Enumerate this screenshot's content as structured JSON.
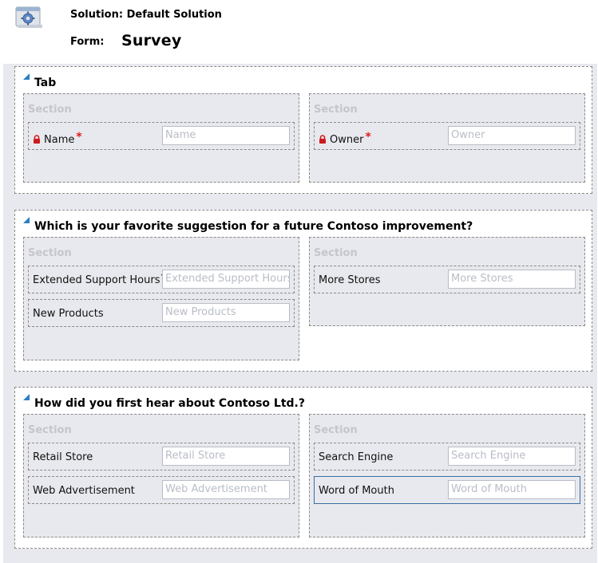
{
  "header": {
    "solution_label": "Solution: Default Solution",
    "form_label": "Form:",
    "form_name": "Survey",
    "icon": "gear-settings-icon"
  },
  "tabs": [
    {
      "title": "Tab",
      "sections": [
        {
          "label": "Section",
          "fields": [
            {
              "label": "Name",
              "placeholder": "Name",
              "locked": true,
              "required": true
            }
          ]
        },
        {
          "label": "Section",
          "fields": [
            {
              "label": "Owner",
              "placeholder": "Owner",
              "locked": true,
              "required": true
            }
          ]
        }
      ]
    },
    {
      "title": "Which is your favorite suggestion for a future Contoso improvement?",
      "sections": [
        {
          "label": "Section",
          "fields": [
            {
              "label": "Extended Support Hours`",
              "placeholder": "Extended Support Hours`"
            },
            {
              "label": "New Products",
              "placeholder": "New Products"
            }
          ]
        },
        {
          "label": "Section",
          "fields": [
            {
              "label": "More Stores",
              "placeholder": "More Stores"
            }
          ]
        }
      ]
    },
    {
      "title": "How did you first hear about Contoso Ltd.?",
      "sections": [
        {
          "label": "Section",
          "fields": [
            {
              "label": "Retail Store",
              "placeholder": "Retail Store"
            },
            {
              "label": "Web Advertisement",
              "placeholder": "Web Advertisement"
            }
          ]
        },
        {
          "label": "Section",
          "fields": [
            {
              "label": "Search Engine",
              "placeholder": "Search Engine"
            },
            {
              "label": "Word of Mouth",
              "placeholder": "Word of Mouth",
              "selected": true
            }
          ]
        }
      ]
    }
  ],
  "colors": {
    "accent": "#2b7dc6",
    "required": "#e0191b",
    "lock": "#cc1b1b",
    "canvas": "#e8e9ef",
    "selected_border": "#3a6ea5"
  }
}
